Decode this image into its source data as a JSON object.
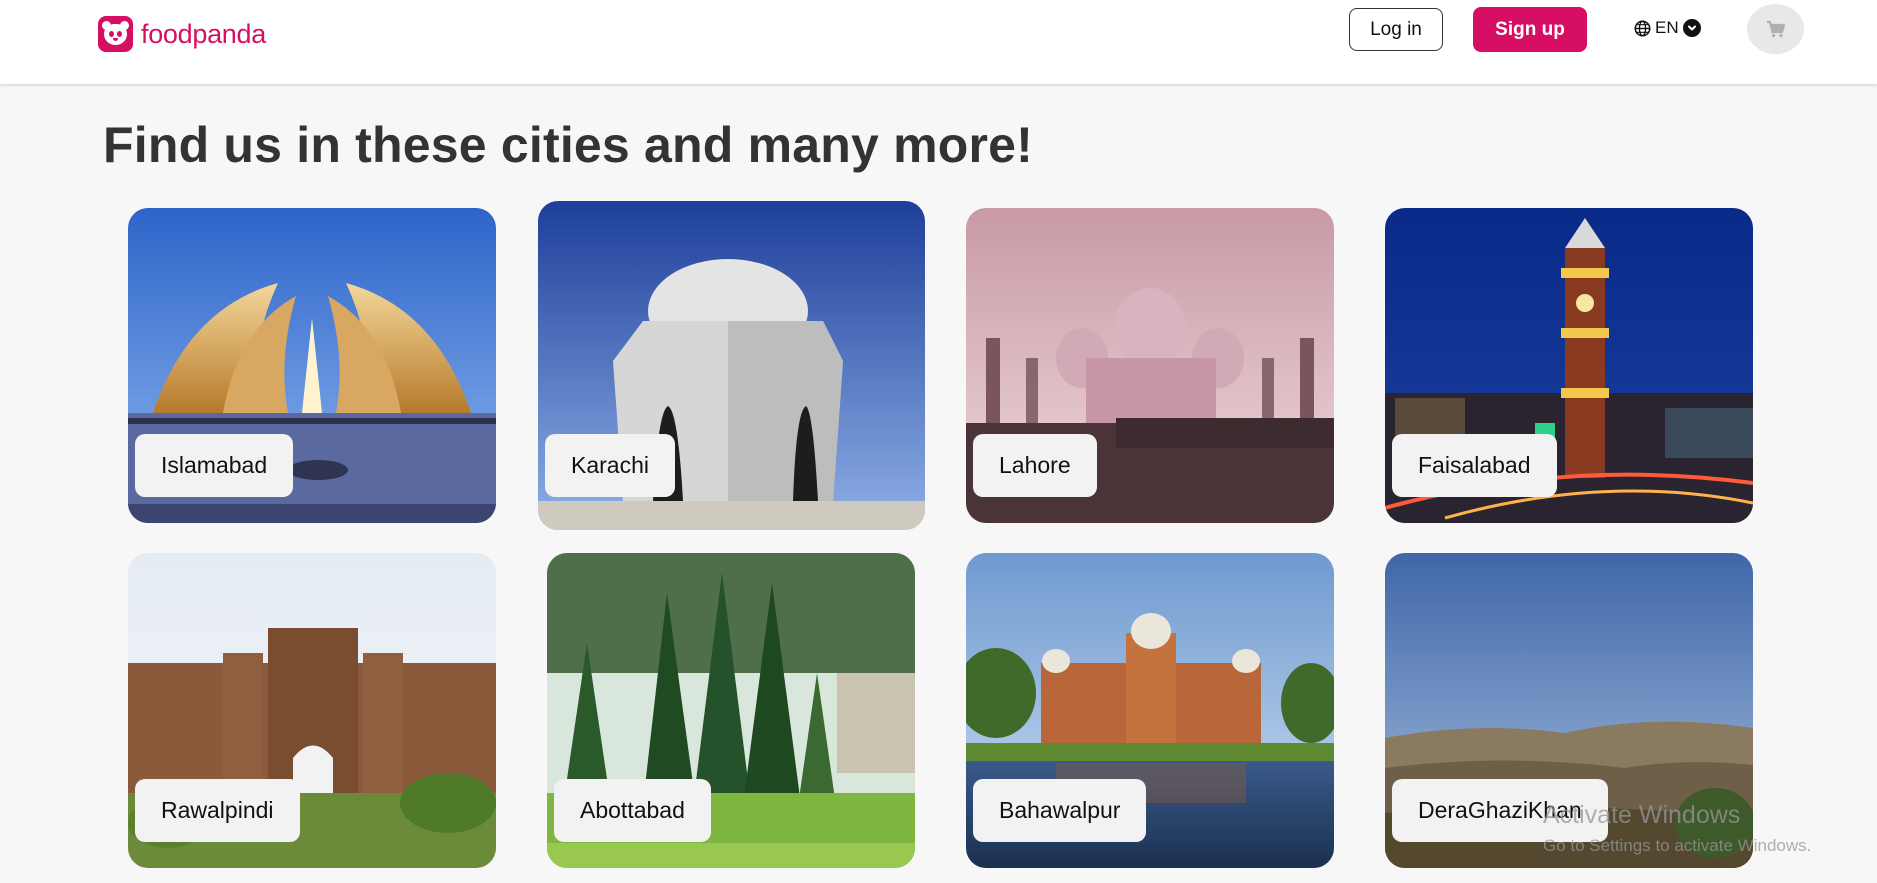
{
  "header": {
    "brand": "foodpanda",
    "login_label": "Log in",
    "signup_label": "Sign up",
    "language": "EN",
    "icons": [
      "panda-logo-icon",
      "globe-icon",
      "chevron-down-icon",
      "cart-icon"
    ]
  },
  "main": {
    "title": "Find us in these cities and many more!",
    "cities": [
      {
        "name": "Islamabad"
      },
      {
        "name": "Karachi"
      },
      {
        "name": "Lahore"
      },
      {
        "name": "Faisalabad"
      },
      {
        "name": "Rawalpindi"
      },
      {
        "name": "Abottabad"
      },
      {
        "name": "Bahawalpur"
      },
      {
        "name": "DeraGhaziKhan"
      }
    ]
  },
  "watermark": {
    "line1": "Activate Windows",
    "line2": "Go to Settings to activate Windows."
  },
  "colors": {
    "brand": "#d70f64",
    "background": "#f7f7f7"
  }
}
